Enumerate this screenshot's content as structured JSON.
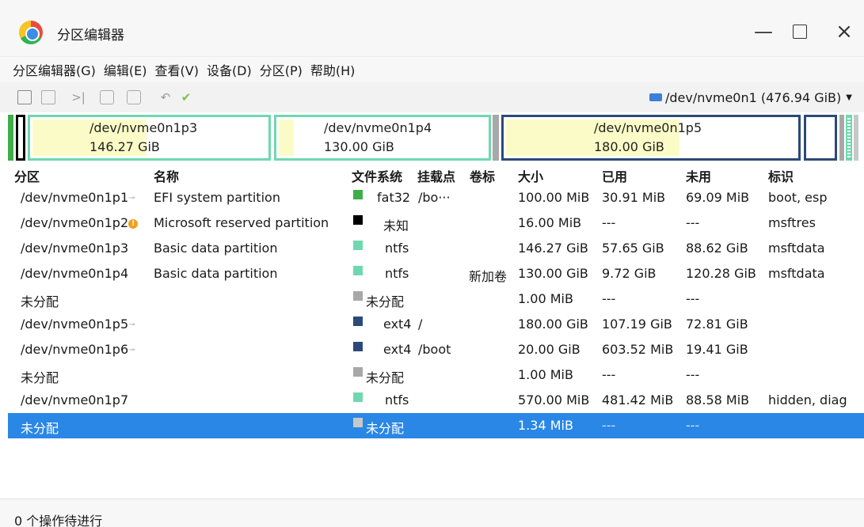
{
  "window": {
    "title": "分区编辑器",
    "minimize_glyph": "—",
    "close_glyph": "×"
  },
  "menu": [
    "分区编辑器(G)",
    "编辑(E)",
    "查看(V)",
    "设备(D)",
    "分区(P)",
    "帮助(H)"
  ],
  "toolbar": {
    "icons": [
      "new-partition-icon",
      "delete-icon",
      "resize-icon",
      "copy-icon",
      "paste-icon",
      "undo-icon",
      "apply-icon"
    ]
  },
  "device": {
    "label": "/dev/nvme0n1 (476.94 GiB)"
  },
  "map": {
    "partitions": [
      {
        "path": "/dev/nvme0n1p3",
        "size": "146.27 GiB"
      },
      {
        "path": "/dev/nvme0n1p4",
        "size": "130.00 GiB"
      },
      {
        "path": "/dev/nvme0n1p5",
        "size": "180.00 GiB"
      }
    ]
  },
  "table": {
    "headers": [
      "分区",
      "名称",
      "文件系统",
      "挂载点",
      "卷标",
      "大小",
      "已用",
      "未用",
      "标识"
    ],
    "rows": [
      {
        "partition": "/dev/nvme0n1p1",
        "name": "EFI system partition",
        "fs": "fat32",
        "fs_color": "#3fae49",
        "mount": "/bo···",
        "label": "",
        "size": "100.00 MiB",
        "used": "30.91 MiB",
        "unused": "69.09 MiB",
        "flags": "boot, esp"
      },
      {
        "partition": "/dev/nvme0n1p2",
        "name": "Microsoft reserved partition",
        "fs": "未知",
        "fs_color": "#000000",
        "mount": "",
        "label": "",
        "size": "16.00 MiB",
        "used": "---",
        "unused": "---",
        "flags": "msftres"
      },
      {
        "partition": "/dev/nvme0n1p3",
        "name": "Basic data partition",
        "fs": "ntfs",
        "fs_color": "#6fd8b0",
        "mount": "",
        "label": "",
        "size": "146.27 GiB",
        "used": "57.65 GiB",
        "unused": "88.62 GiB",
        "flags": "msftdata"
      },
      {
        "partition": "/dev/nvme0n1p4",
        "name": "Basic data partition",
        "fs": "ntfs",
        "fs_color": "#6fd8b0",
        "mount": "",
        "label": "新加卷",
        "size": "130.00 GiB",
        "used": "9.72 GiB",
        "unused": "120.28 GiB",
        "flags": "msftdata"
      },
      {
        "partition": "未分配",
        "name": "",
        "fs": "未分配",
        "fs_color": "#a8a8a8",
        "mount": "",
        "label": "",
        "size": "1.00 MiB",
        "used": "---",
        "unused": "---",
        "flags": ""
      },
      {
        "partition": "/dev/nvme0n1p5",
        "name": "",
        "fs": "ext4",
        "fs_color": "#2c4a78",
        "mount": "/",
        "label": "",
        "size": "180.00 GiB",
        "used": "107.19 GiB",
        "unused": "72.81 GiB",
        "flags": ""
      },
      {
        "partition": "/dev/nvme0n1p6",
        "name": "",
        "fs": "ext4",
        "fs_color": "#2c4a78",
        "mount": "/boot",
        "label": "",
        "size": "20.00 GiB",
        "used": "603.52 MiB",
        "unused": "19.41 GiB",
        "flags": ""
      },
      {
        "partition": "未分配",
        "name": "",
        "fs": "未分配",
        "fs_color": "#a8a8a8",
        "mount": "",
        "label": "",
        "size": "1.00 MiB",
        "used": "---",
        "unused": "---",
        "flags": ""
      },
      {
        "partition": "/dev/nvme0n1p7",
        "name": "",
        "fs": "ntfs",
        "fs_color": "#6fd8b0",
        "mount": "",
        "label": "",
        "size": "570.00 MiB",
        "used": "481.42 MiB",
        "unused": "88.58 MiB",
        "flags": "hidden, diag"
      },
      {
        "partition": "未分配",
        "name": "",
        "fs": "未分配",
        "fs_color": "#c8c8c8",
        "mount": "",
        "label": "",
        "size": "1.34 MiB",
        "used": "---",
        "unused": "---",
        "flags": ""
      }
    ],
    "selected_row": 9
  },
  "status": {
    "pending_ops": "0 个操作待进行"
  },
  "colors": {
    "accent": "#2a87e5",
    "ntfs_border": "#6fd8b0",
    "ext4_border": "#2c4a78",
    "unallocated": "#a8a8a8",
    "used_fill": "#fbfbc8"
  }
}
